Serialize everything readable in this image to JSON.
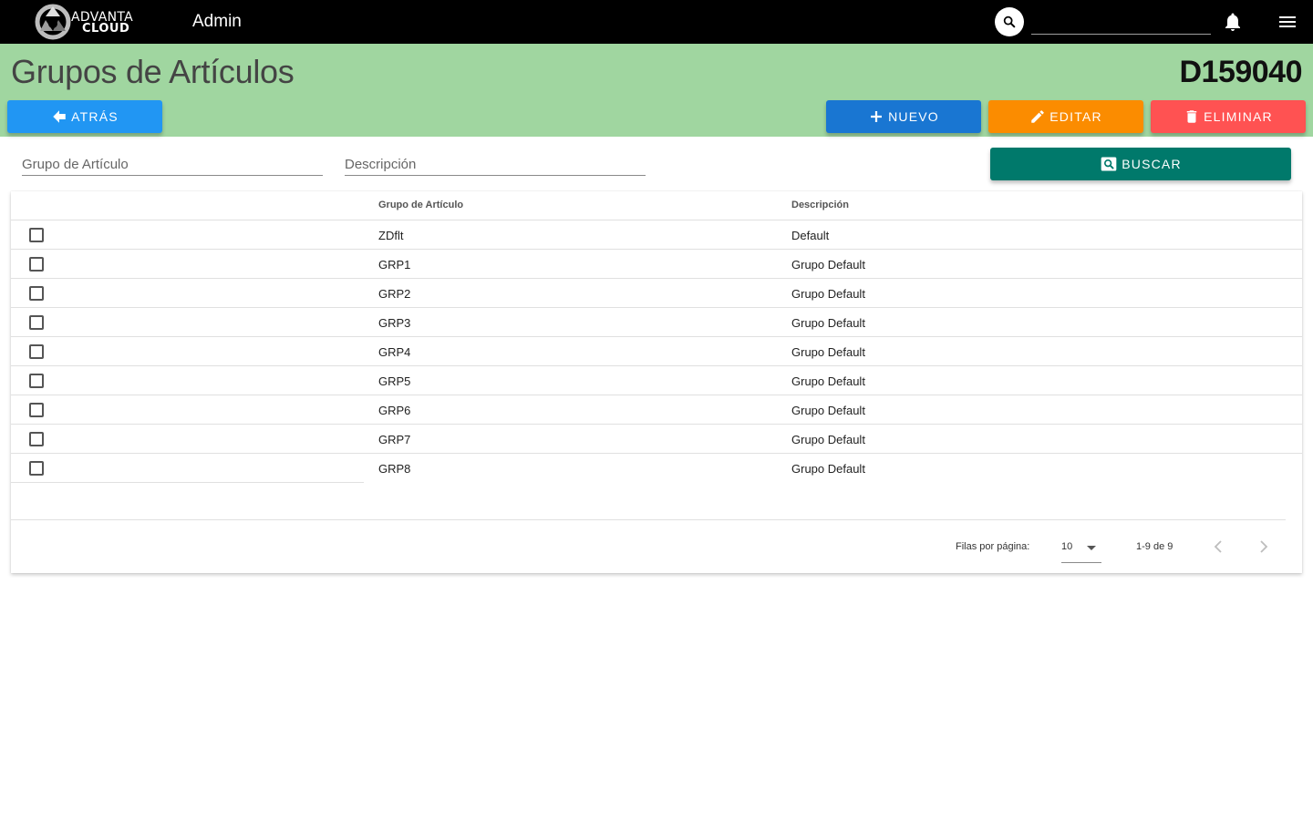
{
  "topbar": {
    "logo_line1": "ADVANTA",
    "logo_line2": "CLOUD",
    "app_title": "Admin",
    "search_placeholder": ""
  },
  "header": {
    "title": "Grupos de Artículos",
    "company_code": "D159040",
    "background": "#a0d6a0"
  },
  "actions": {
    "back_label": "ATRÁS",
    "new_label": "NUEVO",
    "edit_label": "EDITAR",
    "delete_label": "ELIMINAR",
    "search_label": "BUSCAR"
  },
  "filters": {
    "grupo_placeholder": "Grupo de Artículo",
    "descripcion_placeholder": "Descripción"
  },
  "table": {
    "headers": {
      "grupo": "Grupo de Artículo",
      "descripcion": "Descripción"
    },
    "rows": [
      {
        "grupo": "ZDflt",
        "descripcion": "Default",
        "selected": false
      },
      {
        "grupo": "GRP1",
        "descripcion": "Grupo Default",
        "selected": false
      },
      {
        "grupo": "GRP2",
        "descripcion": "Grupo Default",
        "selected": false
      },
      {
        "grupo": "GRP3",
        "descripcion": "Grupo Default",
        "selected": false
      },
      {
        "grupo": "GRP4",
        "descripcion": "Grupo Default",
        "selected": false
      },
      {
        "grupo": "GRP5",
        "descripcion": "Grupo Default",
        "selected": false
      },
      {
        "grupo": "GRP6",
        "descripcion": "Grupo Default",
        "selected": false
      },
      {
        "grupo": "GRP7",
        "descripcion": "Grupo Default",
        "selected": false
      },
      {
        "grupo": "GRP8",
        "descripcion": "Grupo Default",
        "selected": false
      }
    ]
  },
  "pagination": {
    "rows_per_page_label": "Filas por página:",
    "rows_per_page_value": "10",
    "page_info": "1-9 de 9"
  },
  "colors": {
    "topbar": "#000000",
    "back": "#2196f3",
    "new": "#1976d2",
    "edit": "#fb8c00",
    "delete": "#ff5252",
    "search": "#00796b"
  },
  "icons": {
    "logo": "advanta-cloud-logo",
    "search": "search-icon",
    "bell": "bell-icon",
    "menu": "menu-icon",
    "back": "arrow-left-icon",
    "new": "plus-icon",
    "edit": "pencil-icon",
    "delete": "trash-icon",
    "find": "find-icon",
    "caret": "caret-down-icon",
    "prev": "chevron-left-icon",
    "next": "chevron-right-icon"
  }
}
